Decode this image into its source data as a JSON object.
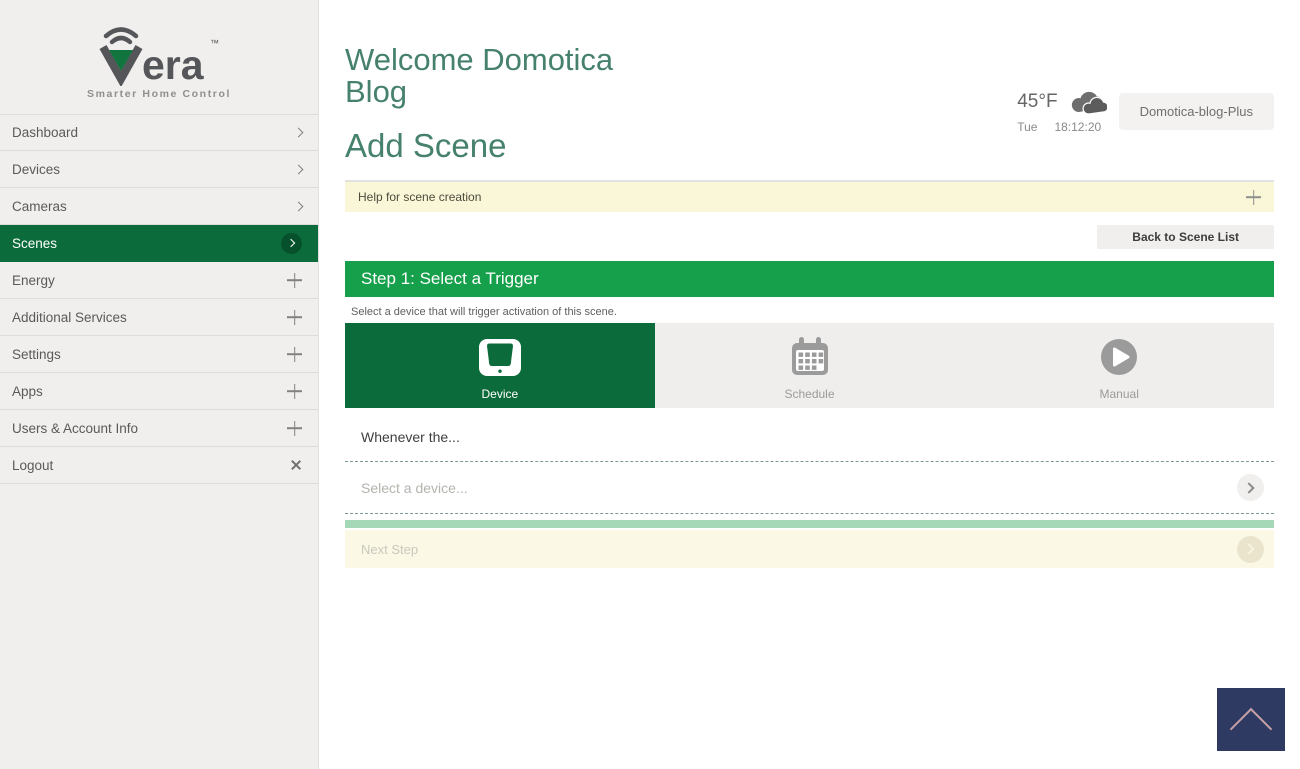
{
  "colors": {
    "brand_dark_green": "#0c6b3a",
    "step_green": "#17a04b",
    "progress_light_green": "#a5d8b6",
    "help_yellow": "#faf6d8",
    "next_pale_yellow": "#fbf8e5",
    "heading_green": "#46816b",
    "sidebar_bg": "#f0efed",
    "back_to_top_navy": "#2e3a62"
  },
  "icons": {
    "sidebar_expand": "chevron-right",
    "sidebar_section_add": "plus",
    "logout": "close-x",
    "weather": "clouds",
    "trigger_device": "tablet-device",
    "trigger_schedule": "calendar",
    "trigger_manual": "play-circle",
    "help_expand": "plus",
    "row_next": "chevron-right-circle",
    "back_to_top": "chevron-up"
  },
  "sidebar": {
    "logo": {
      "era": "era",
      "tm": "™",
      "tagline": "Smarter Home Control"
    },
    "items": [
      {
        "label": "Dashboard",
        "icon": "chevron-right",
        "selected": false
      },
      {
        "label": "Devices",
        "icon": "chevron-right",
        "selected": false
      },
      {
        "label": "Cameras",
        "icon": "chevron-right",
        "selected": false
      },
      {
        "label": "Scenes",
        "icon": "chevron-right-circle",
        "selected": true
      },
      {
        "label": "Energy",
        "icon": "plus",
        "selected": false
      },
      {
        "label": "Additional Services",
        "icon": "plus",
        "selected": false
      },
      {
        "label": "Settings",
        "icon": "plus",
        "selected": false
      },
      {
        "label": "Apps",
        "icon": "plus",
        "selected": false
      },
      {
        "label": "Users & Account Info",
        "icon": "plus",
        "selected": false
      },
      {
        "label": "Logout",
        "icon": "close-x",
        "selected": false
      }
    ]
  },
  "header": {
    "welcome_line1": "Welcome Domotica",
    "welcome_line2": "Blog",
    "page_title": "Add Scene",
    "weather": {
      "temp": "45°F",
      "icon": "clouds"
    },
    "day": "Tue",
    "time": "18:12:20",
    "unit_button": "Domotica-blog-Plus"
  },
  "scene": {
    "help_label": "Help for scene creation",
    "back_button": "Back to Scene List",
    "step_title": "Step 1: Select a Trigger",
    "step_subtext": "Select a device that will trigger activation of this scene.",
    "triggers": [
      {
        "label": "Device",
        "icon": "tablet-device",
        "selected": true
      },
      {
        "label": "Schedule",
        "icon": "calendar",
        "selected": false
      },
      {
        "label": "Manual",
        "icon": "play-circle",
        "selected": false
      }
    ],
    "whenever_label": "Whenever the...",
    "select_device_placeholder": "Select a device...",
    "next_step_label": "Next Step"
  }
}
